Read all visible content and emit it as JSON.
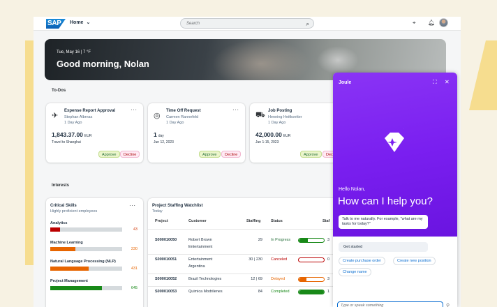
{
  "shell": {
    "logo": "SAP",
    "home": "Home",
    "search_placeholder": "Search"
  },
  "hero": {
    "date": "Tue, May 16 | 7 °F",
    "greeting": "Good morning, Nolan"
  },
  "todos": {
    "label": "To-Dos",
    "cards": [
      {
        "title": "Expense Report Approval",
        "person": "Stephan Albrnas",
        "age": "1 Day Ago",
        "amount": "1,843.37.00",
        "unit": "EUR",
        "detail": "Travel to Shanghai",
        "approve": "Approve",
        "decline": "Decline",
        "icon": "airplane-icon"
      },
      {
        "title": "Time Off Request",
        "person": "Carmen Rannefeld",
        "age": "1 Day Ago",
        "amount": "1",
        "unit": "day",
        "detail": "Jun 12, 2023",
        "approve": "Approve",
        "decline": "Decline",
        "icon": "person-icon"
      },
      {
        "title": "Job Posting",
        "person": "Henning Heitkoetter",
        "age": "1 Day Ago",
        "amount": "42,000.00",
        "unit": "EUR",
        "detail": "Jun 1-15, 2023",
        "approve": "Approve",
        "decline": "Decline",
        "icon": "truck-icon"
      }
    ]
  },
  "interests": {
    "label": "Interests",
    "skills": {
      "title": "Critical Skills",
      "subtitle": "Highly proficient employees",
      "items": [
        {
          "name": "Analytics",
          "value": "43",
          "fill": 0.14,
          "color": "#bb0000",
          "value_color": "#d23a0a"
        },
        {
          "name": "Machine Learning",
          "value": "230",
          "fill": 0.35,
          "color": "#e76500",
          "value_color": "#e76500"
        },
        {
          "name": "Natural Language Processing (NLP)",
          "value": "431",
          "fill": 0.53,
          "color": "#e76500",
          "value_color": "#e76500"
        },
        {
          "name": "Project Management",
          "value": "645",
          "fill": 0.72,
          "color": "#188918",
          "value_color": "#188918"
        }
      ]
    },
    "watchlist": {
      "title": "Project Staffing Watchlist",
      "subtitle": "Today",
      "columns": [
        "Project",
        "Customer",
        "Staffing",
        "Status",
        "Staf"
      ],
      "rows": [
        {
          "project": "S000010050",
          "customer_line1": "Robert Brown",
          "customer_line2": "Entertainment",
          "staffing": "29",
          "status": "In Progress",
          "status_color": "#256f3a",
          "bar_fill": 0.35,
          "bar_color": "#188918",
          "extra": "3"
        },
        {
          "project": "S000010051",
          "customer_line1": "Entertainment",
          "customer_line2": "Argentina",
          "staffing": "30 | 230",
          "status": "Canceled",
          "status_color": "#bb0000",
          "bar_fill": 0,
          "bar_color": "#bb0000",
          "extra": "0"
        },
        {
          "project": "S000010052",
          "customer_line1": "Brazil Technologies",
          "customer_line2": "",
          "staffing": "12 | 69",
          "status": "Delayed",
          "status_color": "#e76500",
          "bar_fill": 0.3,
          "bar_color": "#e76500",
          "extra": "3"
        },
        {
          "project": "S000010053",
          "customer_line1": "Quimica Modrilenes",
          "customer_line2": "",
          "staffing": "84",
          "status": "Completed",
          "status_color": "#188918",
          "bar_fill": 1,
          "bar_color": "#188918",
          "extra": "1"
        }
      ]
    }
  },
  "joule": {
    "title": "Joule",
    "hello": "Hello Nolan,",
    "headline": "How can I help you?",
    "tip": "Talk to me naturally. For example, \"what are my tasks for today?\"",
    "get_started": "Get started",
    "chips": [
      "Create purchase order",
      "Create new position",
      "Change name"
    ],
    "input_placeholder": "Type or speak something"
  }
}
